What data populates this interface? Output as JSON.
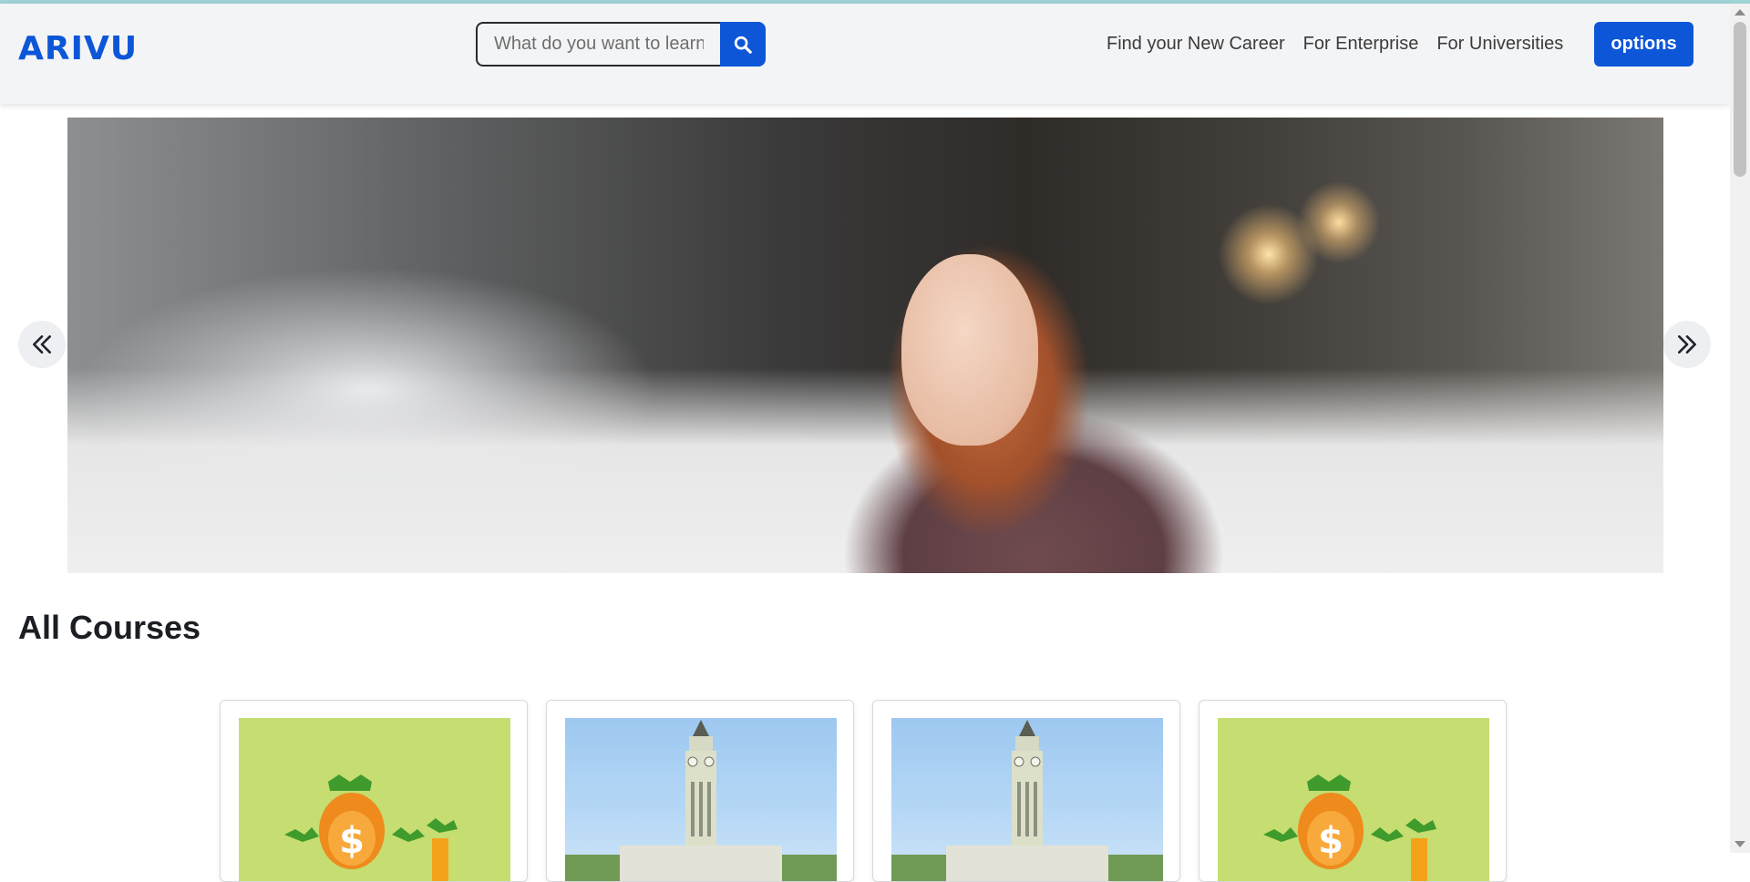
{
  "header": {
    "brand": "ARIVU",
    "search": {
      "placeholder": "What do you want to learn?",
      "value": ""
    },
    "nav": [
      {
        "label": "Find your New Career"
      },
      {
        "label": "For Enterprise"
      },
      {
        "label": "For Universities"
      }
    ],
    "options_label": "options"
  },
  "hero": {
    "prev_icon": "chevron-double-left-icon",
    "next_icon": "chevron-double-right-icon"
  },
  "courses_section": {
    "title": "All Courses",
    "cards": [
      {
        "image": "money-bag-illustration"
      },
      {
        "image": "clock-tower-photo"
      },
      {
        "image": "clock-tower-photo"
      },
      {
        "image": "money-bag-illustration"
      }
    ]
  },
  "colors": {
    "brand": "#0d56d8",
    "header_bg": "#f3f4f6",
    "card_money_bg": "#c5dd71"
  }
}
